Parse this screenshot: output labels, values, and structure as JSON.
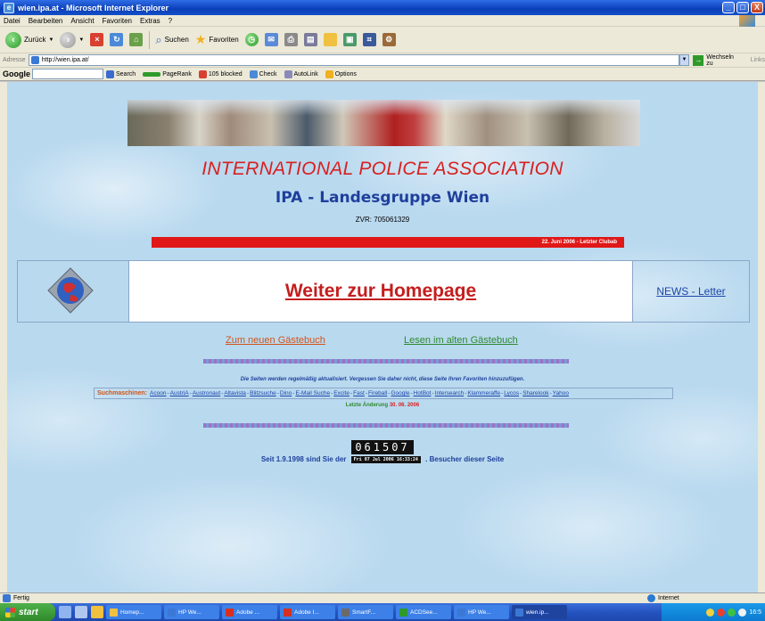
{
  "window": {
    "title": "wien.ipa.at - Microsoft Internet Explorer",
    "controls": {
      "minimize": "_",
      "maximize": "□",
      "close": "X"
    }
  },
  "menu": [
    "Datei",
    "Bearbeiten",
    "Ansicht",
    "Favoriten",
    "Extras",
    "?"
  ],
  "toolbar": {
    "back_label": "Zurück",
    "search_label": "Suchen",
    "favorites_label": "Favoriten"
  },
  "address": {
    "label": "Adresse",
    "url": "http://wien.ipa.at/",
    "go_label": "Wechseln zu",
    "links_label": "Links"
  },
  "google_toolbar": {
    "logo": "Google",
    "search_label": "Search",
    "pagerank_label": "PageRank",
    "blocked_label": "105 blocked",
    "check_label": "Check",
    "autolink_label": "AutoLink",
    "options_label": "Options"
  },
  "page": {
    "title": "INTERNATIONAL POLICE ASSOCIATION",
    "subtitle": "IPA - Landesgruppe Wien",
    "zvr": "ZVR: 705061329",
    "redbar_text": "22. Juni 2006 - Letzter Clubab",
    "homepage_link": "Weiter zur Homepage",
    "news_link": "NEWS - Letter",
    "guestbook_new": "Zum neuen Gästebuch",
    "guestbook_old": "Lesen im alten Gästebuch",
    "update_note": "Die Seiten werden regelmäßig aktualisiert. Vergessen Sie daher nicht, diese Seite Ihren Favoriten hinzuzufügen.",
    "search_label": "Suchmaschinen:",
    "engines": [
      "Acoon",
      "AustriA",
      "Austronaut",
      "Altavista",
      "Blitzsuche",
      "Dino",
      "E-Mail Suche",
      "Excite",
      "Fast",
      "Fireball",
      "Google",
      "HotBot",
      "Intersearch",
      "Klammeraffe",
      "Lycos",
      "Sharelook",
      "Yahoo"
    ],
    "last_change_label": "Letzte Änderung",
    "last_change_date": "30. 06. 2006",
    "counter": "061507",
    "visitors_prefix": "Seit 1.9.1998 sind Sie der",
    "visitors_stamp": "Fri 07 Jul 2006 16:33:24",
    "visitors_suffix": ". Besucher dieser Seite"
  },
  "status": {
    "text": "Fertig",
    "zone": "Internet"
  },
  "taskbar": {
    "start": "start",
    "tasks": [
      "Homep...",
      "HP We...",
      "Adobe ...",
      "Adobe I...",
      "SmartF...",
      "ACDSee...",
      "HP We...",
      "wien.ip..."
    ],
    "clock": "16:5"
  },
  "colors": {
    "title_red": "#d92020",
    "subtitle_blue": "#1f3f9c",
    "link_orange": "#d2541a",
    "link_green": "#2f8a2f",
    "page_bg": "#b9d9ef"
  }
}
